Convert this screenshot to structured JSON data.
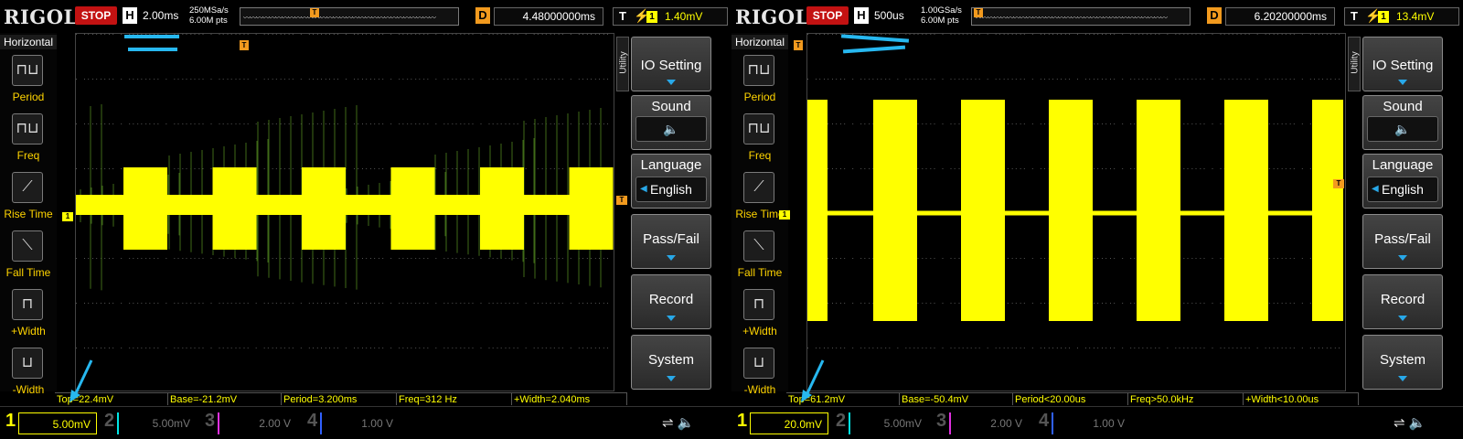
{
  "panels": [
    {
      "logo": "RIGOL",
      "status": "STOP",
      "horizontal_label": "H",
      "timebase": "2.00ms",
      "sample_rate": "250MSa/s",
      "memory_depth": "6.00M pts",
      "delay_label": "D",
      "delay": "4.48000000ms",
      "trigger_label": "T",
      "trigger_channel": "1",
      "trigger_level": "1.40mV",
      "measure_menu": {
        "title": "Horizontal",
        "items": [
          "Period",
          "Freq",
          "Rise Time",
          "Fall Time",
          "+Width",
          "-Width"
        ]
      },
      "utility_tab": "Utility",
      "menu": {
        "io_setting": "IO Setting",
        "sound": "Sound",
        "language": "Language",
        "language_value": "English",
        "pass_fail": "Pass/Fail",
        "record": "Record",
        "system": "System"
      },
      "measurements": [
        "Top=22.4mV",
        "Base=-21.2mV",
        "Period=3.200ms",
        "Freq=312 Hz",
        "+Width=2.040ms"
      ],
      "channels": [
        {
          "num": "1",
          "scale": "5.00mV",
          "color": "#ffff00",
          "active": true
        },
        {
          "num": "2",
          "scale": "5.00mV",
          "color": "#00e6e6",
          "active": false
        },
        {
          "num": "3",
          "scale": "2.00 V",
          "color": "#e030e0",
          "active": false
        },
        {
          "num": "4",
          "scale": "1.00 V",
          "color": "#3060ff",
          "active": false
        }
      ],
      "waveform": {
        "bursts": 6,
        "amplitude_mv": 22.4,
        "baseline_mv": -21.2
      }
    },
    {
      "logo": "RIGOL",
      "status": "STOP",
      "horizontal_label": "H",
      "timebase": "500us",
      "sample_rate": "1.00GSa/s",
      "memory_depth": "6.00M pts",
      "delay_label": "D",
      "delay": "6.20200000ms",
      "trigger_label": "T",
      "trigger_channel": "1",
      "trigger_level": "13.4mV",
      "measure_menu": {
        "title": "Horizontal",
        "items": [
          "Period",
          "Freq",
          "Rise Time",
          "Fall Time",
          "+Width",
          "-Width"
        ]
      },
      "utility_tab": "Utility",
      "menu": {
        "io_setting": "IO Setting",
        "sound": "Sound",
        "language": "Language",
        "language_value": "English",
        "pass_fail": "Pass/Fail",
        "record": "Record",
        "system": "System"
      },
      "measurements": [
        "Top=61.2mV",
        "Base=-50.4mV",
        "Period<20.00us",
        "Freq>50.0kHz",
        "+Width<10.00us"
      ],
      "channels": [
        {
          "num": "1",
          "scale": "20.0mV",
          "color": "#ffff00",
          "active": true
        },
        {
          "num": "2",
          "scale": "5.00mV",
          "color": "#00e6e6",
          "active": false
        },
        {
          "num": "3",
          "scale": "2.00 V",
          "color": "#e030e0",
          "active": false
        },
        {
          "num": "4",
          "scale": "1.00 V",
          "color": "#3060ff",
          "active": false
        }
      ],
      "waveform": {
        "bursts": 7,
        "amplitude_mv": 61.2,
        "baseline_mv": -50.4
      }
    }
  ]
}
